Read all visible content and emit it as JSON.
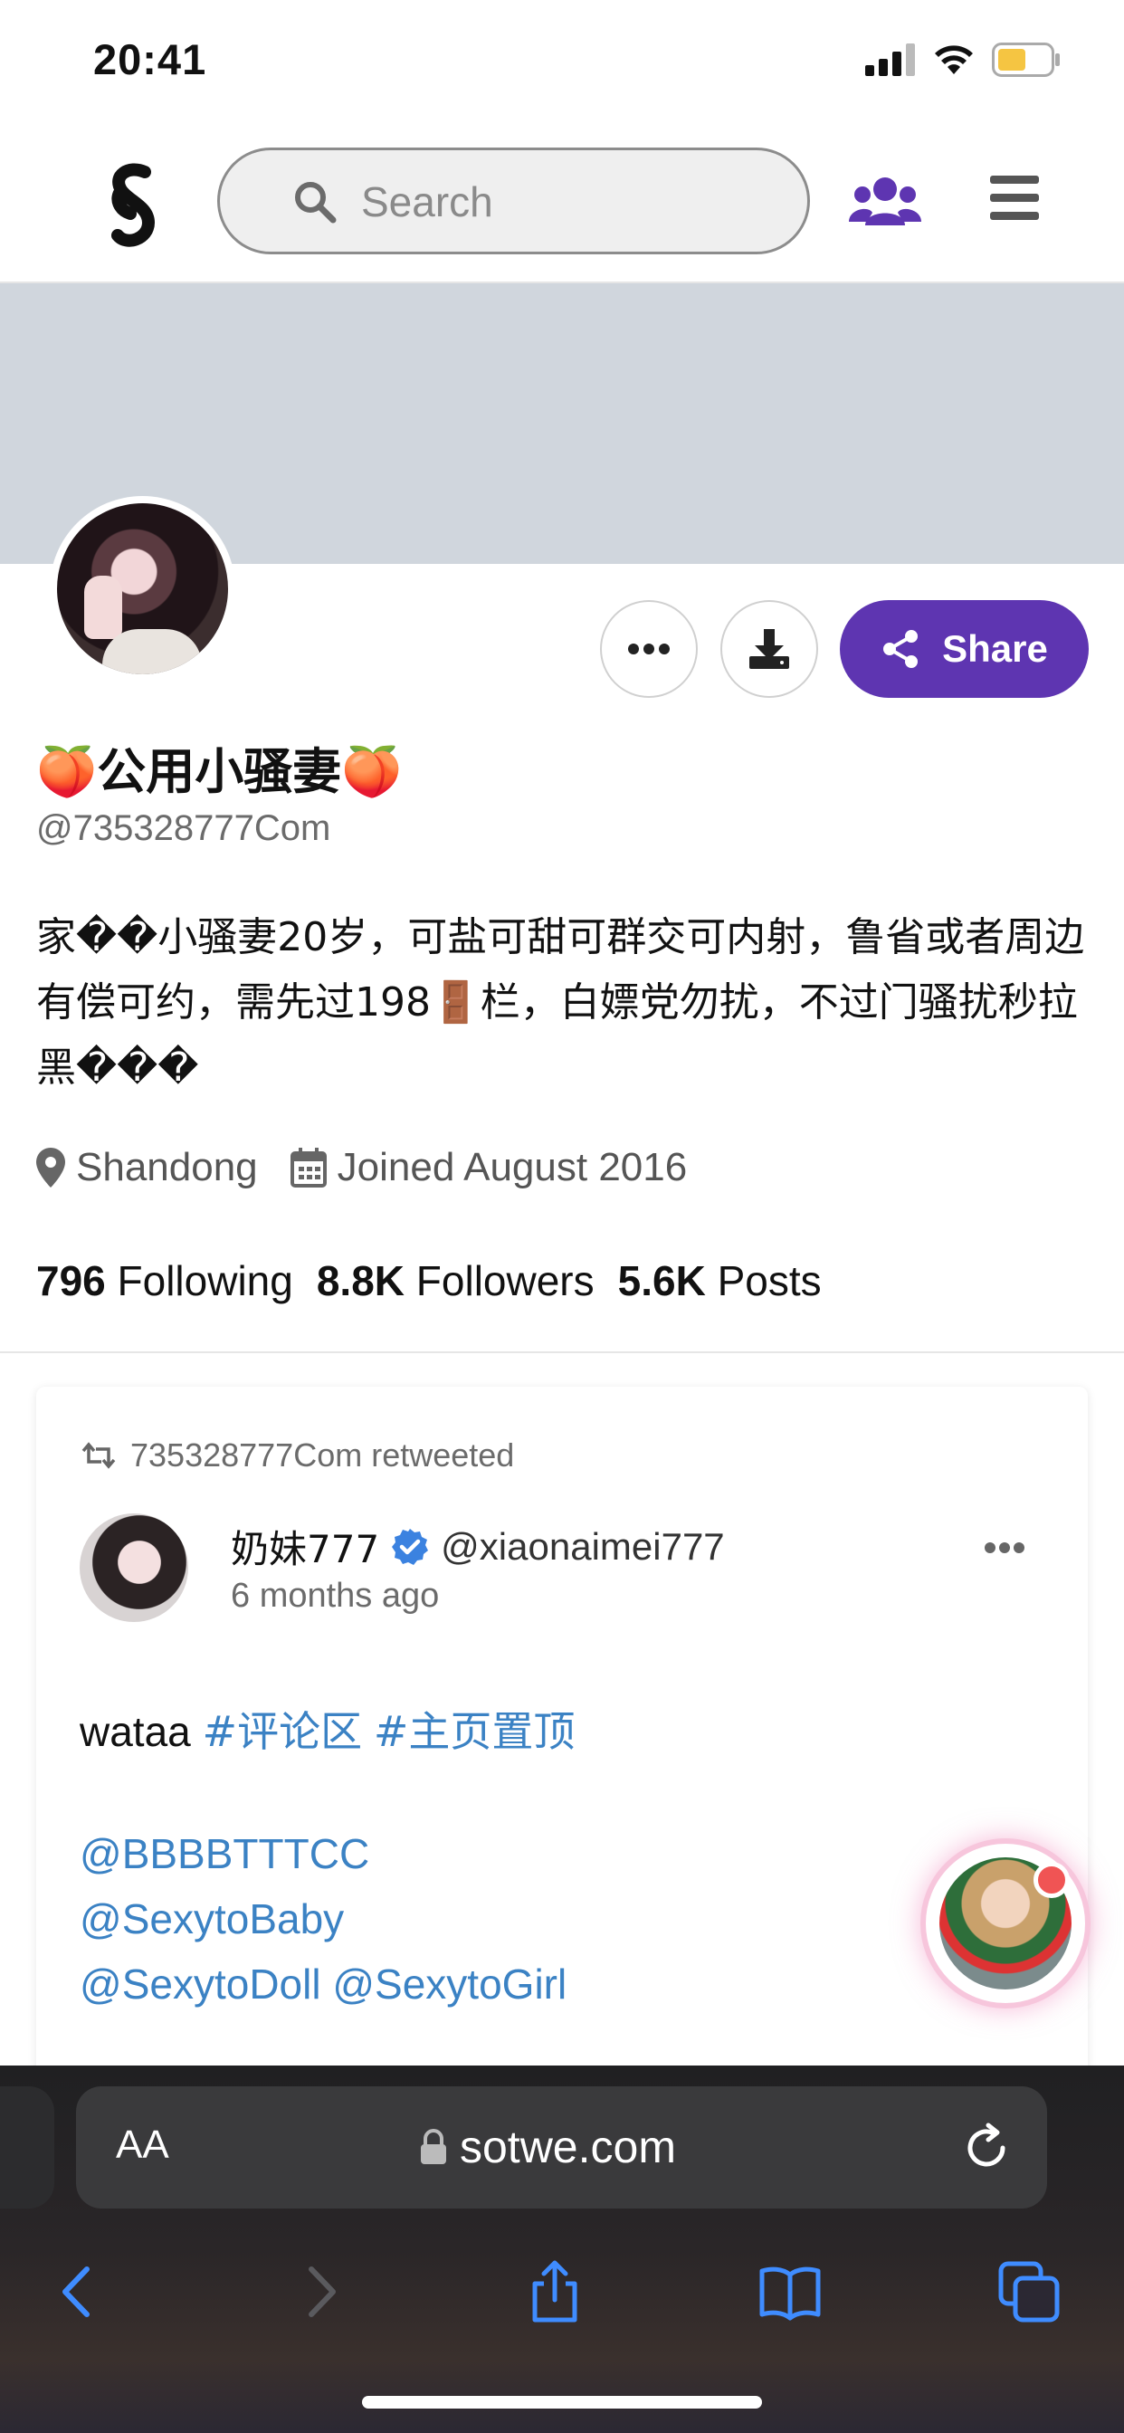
{
  "status_bar": {
    "time": "20:41"
  },
  "header": {
    "search_placeholder": "Search",
    "icons": [
      "logo-icon",
      "search-icon",
      "users-icon",
      "menu-icon"
    ],
    "accent_color": "#5e35b1"
  },
  "profile": {
    "display_name": "🍑公用小骚妻🍑",
    "handle": "@735328777Com",
    "bio": "家��小骚妻20岁，可盐可甜可群交可内射，鲁省或者周边有偿可约，需先过198🚪栏，白嫖党勿扰，不过门骚扰秒拉黑���",
    "location": "Shandong",
    "joined": "Joined August 2016",
    "share_label": "Share",
    "stats": {
      "following_count": "796",
      "following_label": "Following",
      "followers_count": "8.8K",
      "followers_label": "Followers",
      "posts_count": "5.6K",
      "posts_label": "Posts"
    }
  },
  "post": {
    "retweet_text": "735328777Com retweeted",
    "author_name": "奶妹777",
    "author_handle": "@xiaonaimei777",
    "time": "6 months ago",
    "text_plain": "wataa",
    "tags": [
      "#评论区",
      "#主页置顶"
    ],
    "mentions_line1": "@BBBBTTTCC",
    "mentions_line2": "@SexytoBaby",
    "mentions_line3": "@SexytoDoll @SexytoGirl",
    "link_color": "#3b82c4"
  },
  "browser": {
    "aa_label": "AA",
    "url": "sotwe.com"
  }
}
